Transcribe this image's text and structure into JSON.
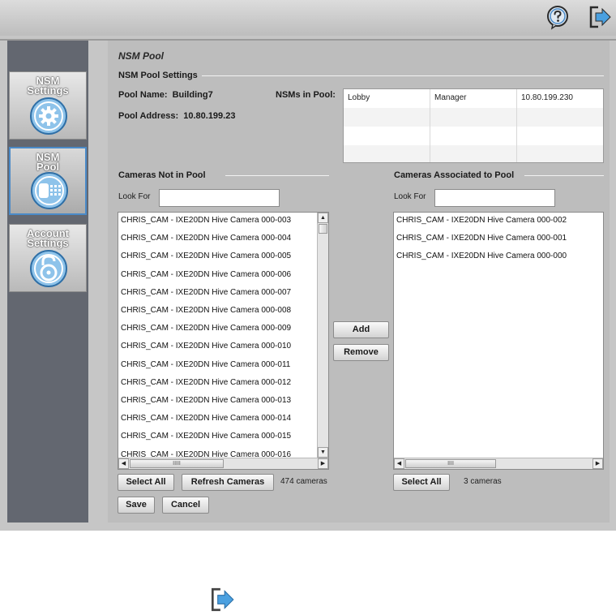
{
  "header": {
    "help_icon": "help-icon",
    "logout_icon": "logout-icon"
  },
  "sidebar": {
    "items": [
      {
        "label": "NSM\nSettings",
        "icon": "gear-icon"
      },
      {
        "label": "NSM\nPool",
        "icon": "camera-pool-icon",
        "active": true
      },
      {
        "label": "Account\nSettings",
        "icon": "lock-icon"
      }
    ]
  },
  "page": {
    "title": "NSM Pool",
    "settings_section": "NSM Pool Settings",
    "pool_name_label": "Pool Name:",
    "pool_name_value": "Building7",
    "pool_address_label": "Pool Address:",
    "pool_address_value": "10.80.199.23",
    "nsms_label": "NSMs in Pool:",
    "nsm_rows": [
      [
        "Lobby",
        "Manager",
        "10.80.199.230"
      ]
    ]
  },
  "not_in_pool": {
    "header": "Cameras Not in Pool",
    "look_for_label": "Look For",
    "look_for_value": "",
    "items": [
      "CHRIS_CAM - IXE20DN Hive Camera 000-003",
      "CHRIS_CAM - IXE20DN Hive Camera 000-004",
      "CHRIS_CAM - IXE20DN Hive Camera 000-005",
      "CHRIS_CAM - IXE20DN Hive Camera 000-006",
      "CHRIS_CAM - IXE20DN Hive Camera 000-007",
      "CHRIS_CAM - IXE20DN Hive Camera 000-008",
      "CHRIS_CAM - IXE20DN Hive Camera 000-009",
      "CHRIS_CAM - IXE20DN Hive Camera 000-010",
      "CHRIS_CAM - IXE20DN Hive Camera 000-011",
      "CHRIS_CAM - IXE20DN Hive Camera 000-012",
      "CHRIS_CAM - IXE20DN Hive Camera 000-013",
      "CHRIS_CAM - IXE20DN Hive Camera 000-014",
      "CHRIS_CAM - IXE20DN Hive Camera 000-015",
      "CHRIS_CAM - IXE20DN Hive Camera 000-016"
    ],
    "select_all": "Select All",
    "refresh": "Refresh Cameras",
    "count": "474 cameras"
  },
  "associated": {
    "header": "Cameras Associated to Pool",
    "look_for_label": "Look For",
    "look_for_value": "",
    "items": [
      "CHRIS_CAM - IXE20DN Hive Camera 000-002",
      "CHRIS_CAM - IXE20DN Hive Camera 000-001",
      "CHRIS_CAM - IXE20DN Hive Camera 000-000"
    ],
    "select_all": "Select All",
    "count": "3 cameras"
  },
  "actions": {
    "add": "Add",
    "remove": "Remove",
    "save": "Save",
    "cancel": "Cancel"
  },
  "colors": {
    "accent": "#4a8ac8",
    "sidebar": "#636770",
    "panel": "#bdbdbd"
  }
}
